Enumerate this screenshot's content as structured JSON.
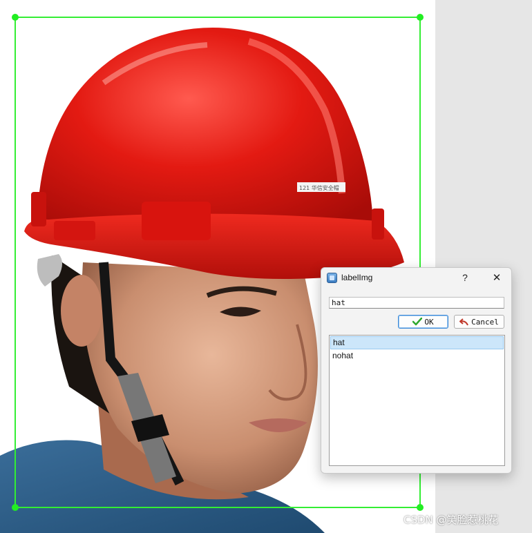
{
  "dialog": {
    "title": "labelImg",
    "help_label": "?",
    "close_label": "✕",
    "input_value": "hat",
    "ok_label": "OK",
    "cancel_label": "Cancel",
    "labels": [
      "hat",
      "nohat"
    ],
    "selected_label": "hat"
  },
  "image": {
    "helmet_label_text": "121 华信安全帽"
  },
  "watermark": "CSDN @笑脸惹桃花",
  "colors": {
    "bbox": "#33ee33",
    "selection": "#cce6fa",
    "helmet": "#e3140f"
  },
  "icons": {
    "app": "labelimg-app-icon",
    "ok": "checkmark-icon",
    "cancel": "undo-arrow-icon"
  }
}
